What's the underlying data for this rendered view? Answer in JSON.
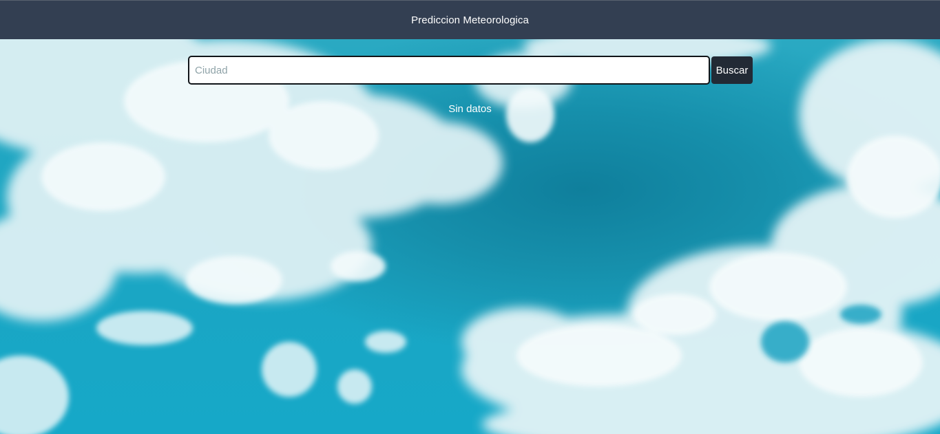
{
  "header": {
    "title": "Prediccion Meteorologica"
  },
  "search": {
    "placeholder": "Ciudad",
    "value": "",
    "button_label": "Buscar"
  },
  "weather": {
    "status_text": "Sin datos"
  },
  "colors": {
    "navbar": "#333f52",
    "button": "#222a35",
    "sky": "#1aa3bd",
    "cloud": "#eaf7f9"
  }
}
